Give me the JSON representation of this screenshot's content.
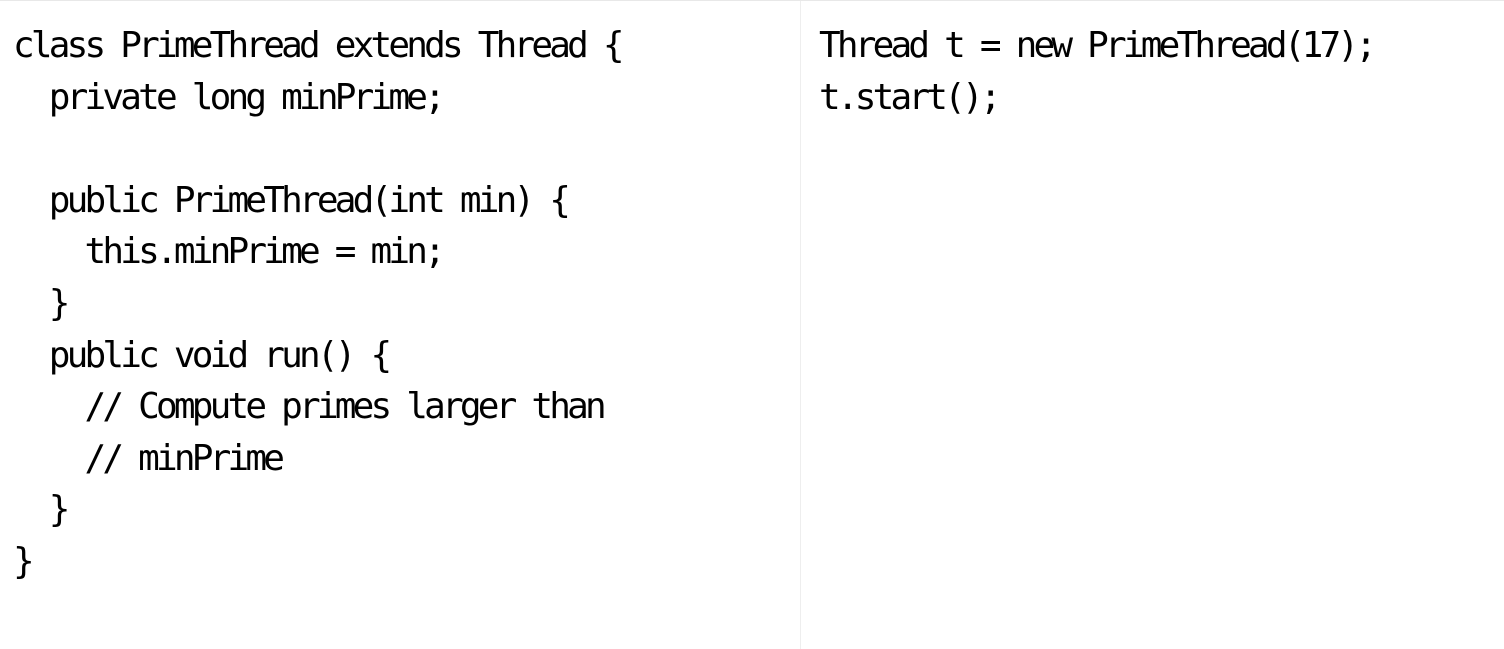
{
  "left_code": {
    "lines": [
      "class PrimeThread extends Thread {",
      "  private long minPrime;",
      "",
      "  public PrimeThread(int min) {",
      "    this.minPrime = min;",
      "  }",
      "  public void run() {",
      "    // Compute primes larger than",
      "    // minPrime",
      "  }",
      "}"
    ]
  },
  "right_code": {
    "lines": [
      "Thread t = new PrimeThread(17);",
      "t.start();"
    ]
  }
}
